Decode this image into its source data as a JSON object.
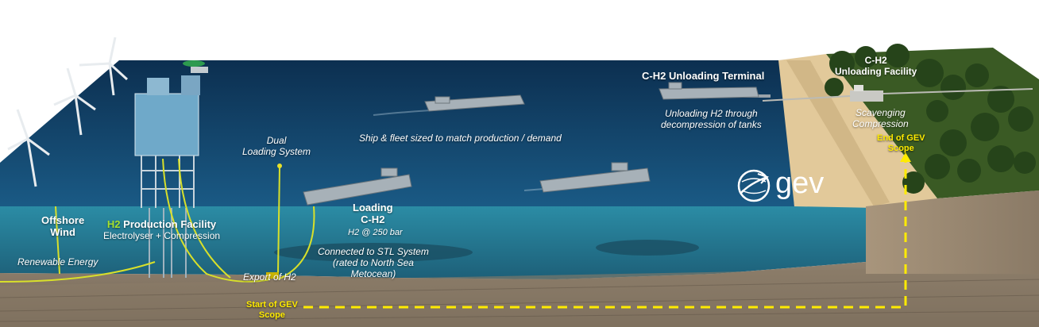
{
  "labels": {
    "offshore_wind": [
      "Offshore",
      "Wind"
    ],
    "production_prefix": "H2",
    "production_title": " Production Facility",
    "production_sub": "Electrolyser + Compression",
    "renewable": "Renewable Energy",
    "dual_loading": [
      "Dual",
      "Loading System"
    ],
    "loading": [
      "Loading",
      "C-H2"
    ],
    "loading_pressure": "H2 @ 250 bar",
    "connected": [
      "Connected to STL System",
      "(rated to North Sea",
      "Metocean)"
    ],
    "export": "Export of H2",
    "start_scope": [
      "Start of GEV",
      "Scope"
    ],
    "ship_fleet": "Ship & fleet sized to match production / demand",
    "unloading_terminal": "C-H2 Unloading Terminal",
    "unloading_desc": [
      "Unloading H2 through",
      "decompression of tanks"
    ],
    "unloading_facility": [
      "C-H2",
      "Unloading Facility"
    ],
    "scavenging": [
      "Scavenging",
      "Compression"
    ],
    "end_scope": [
      "End of GEV",
      "Scope"
    ],
    "logo": "gev"
  },
  "colors": {
    "scope_line": "#ffeb00",
    "h2_accent": "#a6e22e",
    "sea": "#123a5e",
    "underwater": "#2a7d92",
    "land": "#2f4a1c"
  }
}
